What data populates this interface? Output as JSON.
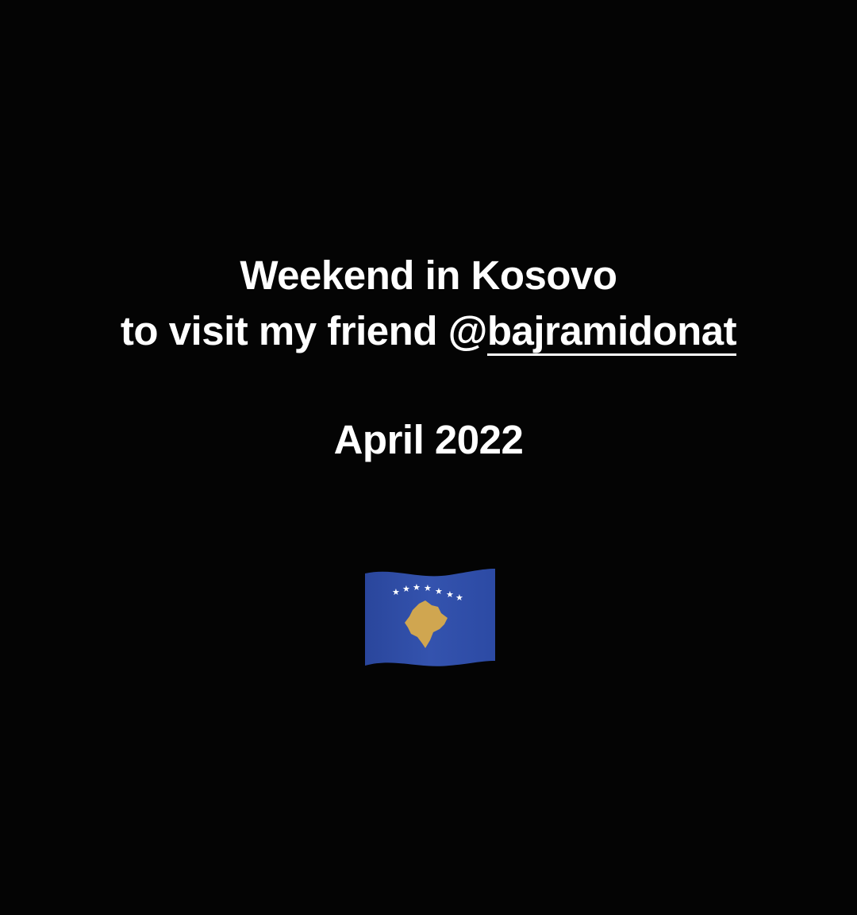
{
  "story": {
    "line1": "Weekend in Kosovo",
    "line2_prefix": "to visit my friend @",
    "mention_handle": "bajramidonat",
    "date_text": "April 2022"
  },
  "sticker": {
    "icon": "kosovo-flag-icon",
    "flag_blue": "#2c4aa4",
    "map_gold": "#d0a650",
    "star_color": "#ffffff"
  },
  "colors": {
    "background": "#040404",
    "text": "#ffffff"
  }
}
